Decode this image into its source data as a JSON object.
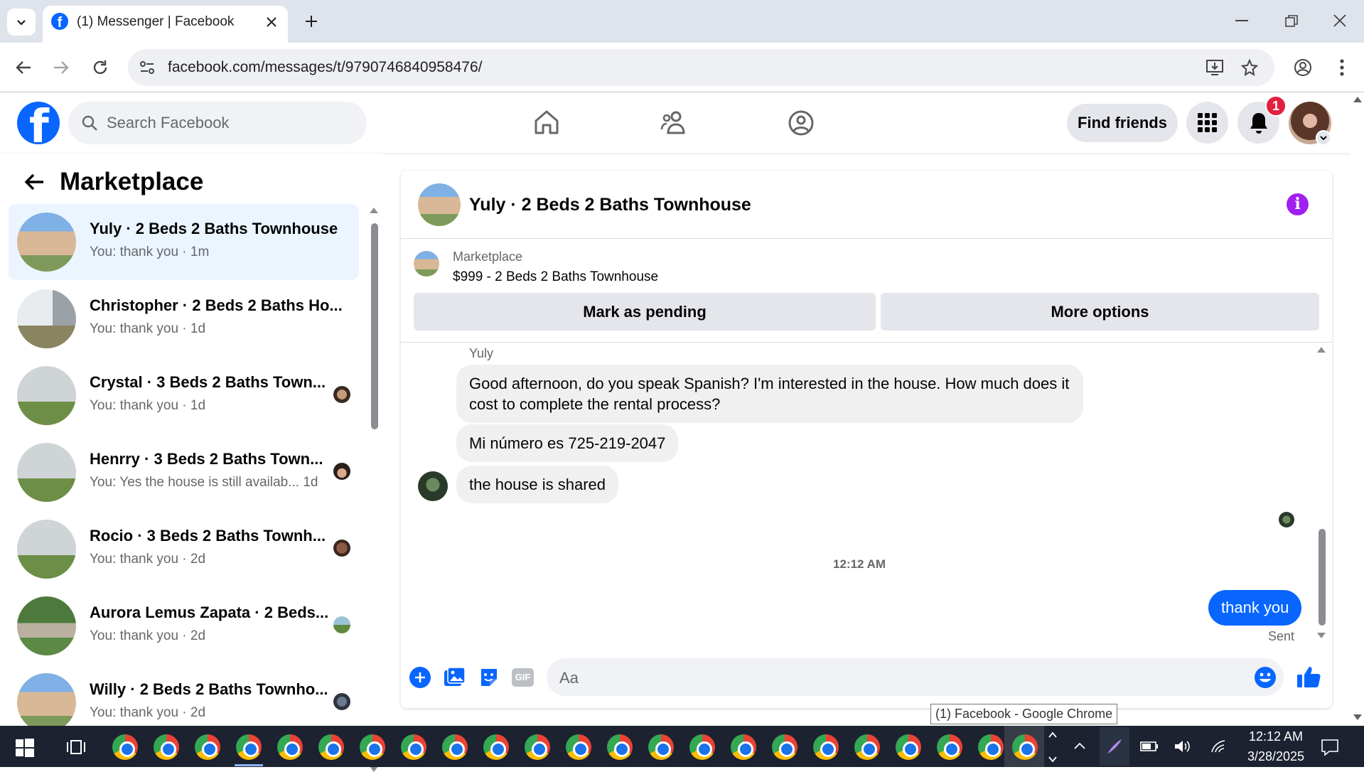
{
  "browser": {
    "tab_title": "(1) Messenger | Facebook",
    "url": "facebook.com/messages/t/9790746840958476/"
  },
  "fb_header": {
    "search_placeholder": "Search Facebook",
    "find_friends": "Find friends",
    "notification_count": "1"
  },
  "sidebar": {
    "title": "Marketplace",
    "conversations": [
      {
        "title": "Yuly · 2 Beds 2 Baths Townhouse",
        "preview": "You: thank you · 1m",
        "active": true
      },
      {
        "title": "Christopher · 2 Beds 2 Baths Ho...",
        "preview": "You: thank you · 1d"
      },
      {
        "title": "Crystal · 3 Beds 2 Baths Town...",
        "preview": "You: thank you · 1d"
      },
      {
        "title": "Henrry · 3 Beds 2 Baths Town...",
        "preview": "You: Yes the house is still availab...  1d"
      },
      {
        "title": "Rocio · 3 Beds 2 Baths Townh...",
        "preview": "You: thank you · 2d"
      },
      {
        "title": "Aurora Lemus Zapata · 2 Beds...",
        "preview": "You: thank you · 2d"
      },
      {
        "title": "Willy · 2 Beds 2 Baths Townho...",
        "preview": "You: thank you · 2d"
      }
    ]
  },
  "chat": {
    "title": "Yuly · 2 Beds 2 Baths Townhouse",
    "listing_source": "Marketplace",
    "listing_title": "$999 - 2 Beds 2 Baths Townhouse",
    "mark_pending": "Mark as pending",
    "more_options": "More options",
    "sender_name": "Yuly",
    "messages_in": [
      "Good afternoon, do you speak Spanish? I'm interested in the house. How much does it cost to complete the rental process?",
      "Mi número es 725-219-2047",
      "the house is shared"
    ],
    "timestamp": "12:12 AM",
    "message_out": "thank you",
    "sent_status": "Sent",
    "composer_placeholder": "Aa",
    "gif_label": "GIF"
  },
  "tooltip": "(1) Facebook - Google Chrome",
  "taskbar": {
    "time": "12:12 AM",
    "date": "3/28/2025"
  },
  "colors": {
    "fb_blue": "#0866ff",
    "active_row": "#ebf5ff",
    "info_purple": "#a020f0",
    "badge_red": "#e41e3f"
  }
}
